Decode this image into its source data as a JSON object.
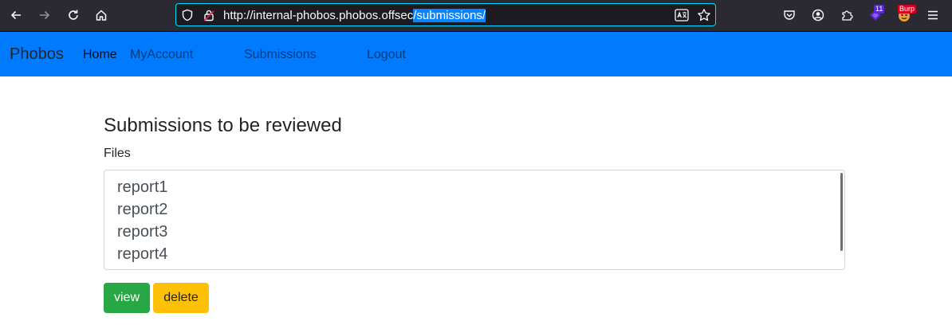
{
  "browser": {
    "url_base": "http://internal-phobos.phobos.offsec",
    "url_selected": "/submissions/",
    "extension_badge": "11",
    "burp_badge": "Burp"
  },
  "navbar": {
    "brand": "Phobos",
    "links": [
      {
        "label": "Home",
        "active": true
      },
      {
        "label": "MyAccount",
        "active": false
      },
      {
        "label": "Submissions",
        "active": false
      },
      {
        "label": "Logout",
        "active": false
      }
    ]
  },
  "main": {
    "heading": "Submissions to be reviewed",
    "files_label": "Files",
    "files": [
      "report1",
      "report2",
      "report3",
      "report4"
    ],
    "buttons": {
      "view": "view",
      "delete": "delete"
    }
  },
  "colors": {
    "navbar_bg": "#007bff",
    "view_button": "#28a745",
    "delete_button": "#ffc107",
    "url_selection": "#0a84ff"
  }
}
